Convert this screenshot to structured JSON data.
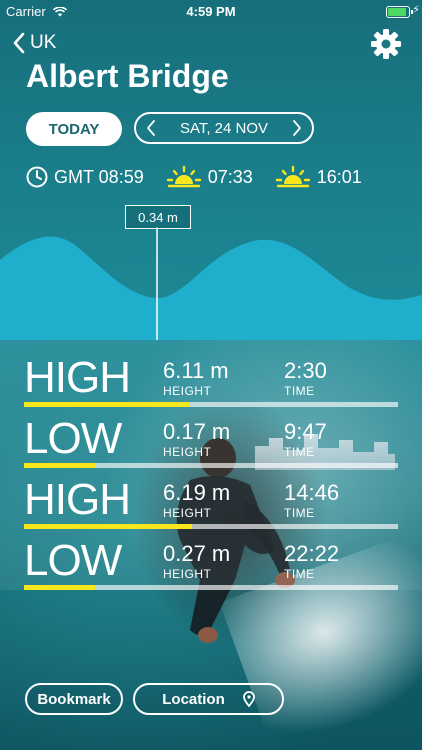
{
  "status_bar": {
    "carrier": "Carrier",
    "time": "4:59 PM"
  },
  "nav": {
    "back_label": "UK",
    "settings_icon": "gear-icon"
  },
  "page": {
    "title": "Albert Bridge"
  },
  "date_controls": {
    "today_label": "TODAY",
    "date": "SAT, 24 NOV"
  },
  "info": {
    "clock_time": "GMT 08:59",
    "sunrise": "07:33",
    "sunset": "16:01",
    "sun_icon_color": "#f8e71c"
  },
  "graph": {
    "current_height": "0.34 m",
    "wave_color": "#1fb2d0"
  },
  "tides": [
    {
      "type": "HIGH",
      "height": "6.11 m",
      "height_label": "HEIGHT",
      "time": "2:30",
      "time_label": "TIME",
      "level": 0.44
    },
    {
      "type": "LOW",
      "height": "0.17 m",
      "height_label": "HEIGHT",
      "time": "9:47",
      "time_label": "TIME",
      "level": 0.19
    },
    {
      "type": "HIGH",
      "height": "6.19 m",
      "height_label": "HEIGHT",
      "time": "14:46",
      "time_label": "TIME",
      "level": 0.45
    },
    {
      "type": "LOW",
      "height": "0.27 m",
      "height_label": "HEIGHT",
      "time": "22:22",
      "time_label": "TIME",
      "level": 0.19
    }
  ],
  "buttons": {
    "bookmark": "Bookmark",
    "location": "Location"
  },
  "colors": {
    "accent": "#f8e71c",
    "today_text": "#1d6770"
  }
}
